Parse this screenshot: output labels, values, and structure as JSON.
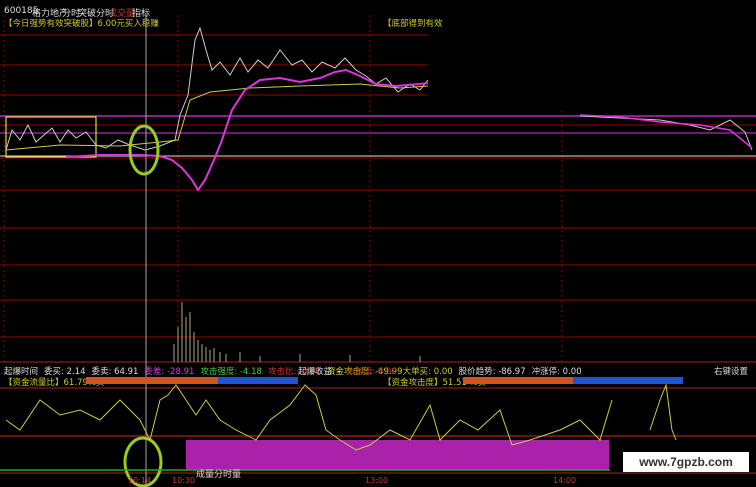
{
  "toolbar": {
    "code": "600185",
    "name": "格力地产",
    "tab_intraday": "分时",
    "tab_breakout": "突破分时",
    "tab_volume": "成交量",
    "tab_indicator": "指标"
  },
  "top_panel": {
    "left_label": "【今日强势有效突破股】6.00元买入稳赚",
    "right_label": "【底部得到有效"
  },
  "legend_row": {
    "items": [
      {
        "label": "起爆时间",
        "color": "#dddddd"
      },
      {
        "label": "委买: 2.14",
        "color": "#dddddd"
      },
      {
        "label": "委卖: 64.91",
        "color": "#dddddd"
      },
      {
        "label": "委差: -28.91",
        "color": "#cc44cc"
      },
      {
        "label": "攻击强度: -4.18",
        "color": "#44cc44"
      },
      {
        "label": "攻击比: -0.01",
        "color": "#cc3333"
      },
      {
        "label": "资金攻击度: -49.99",
        "color": "#cccc22"
      }
    ],
    "items2": [
      {
        "label": "起爆收益: -",
        "color": "#dddddd"
      },
      {
        "label": "大单卖: 0.00",
        "color": "#cc3333"
      },
      {
        "label": "大单买: 0.00",
        "color": "#cccc22"
      },
      {
        "label": "股价趋势: -86.97",
        "color": "#dddddd"
      },
      {
        "label": "冲涨停: 0.00",
        "color": "#dddddd"
      }
    ],
    "settings": "右键设置"
  },
  "lower_panel": {
    "left_label": "【资金流量比】61.79%买",
    "right_label": "【资金攻击度】51.51 %买",
    "volume_label": "成量分时量"
  },
  "time_axis": [
    "10:14",
    "10:30",
    "13:00",
    "14:00"
  ],
  "watermark": "www.7gpzb.com",
  "colors": {
    "price": "#cccccc",
    "avg": "#cccc44",
    "pink": "#dd33dd",
    "grid_red": "#990000",
    "bar_orange": "#cc5522",
    "bar_blue": "#2255cc"
  }
}
